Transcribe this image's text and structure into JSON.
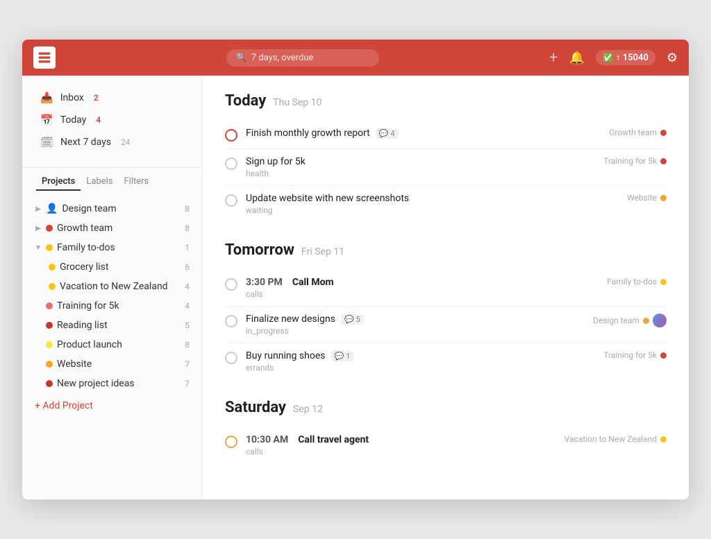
{
  "header": {
    "search_placeholder": "7 days, overdue",
    "karma_label": "↑ 15040",
    "plus_icon": "+",
    "bell_icon": "🔔",
    "settings_icon": "⚙"
  },
  "sidebar": {
    "nav_items": [
      {
        "id": "inbox",
        "label": "Inbox",
        "count": "2",
        "count_type": "red",
        "icon": "inbox"
      },
      {
        "id": "today",
        "label": "Today",
        "count": "4",
        "count_type": "red",
        "icon": "today"
      },
      {
        "id": "next7",
        "label": "Next 7 days",
        "count": "24",
        "count_type": "gray",
        "icon": "calendar"
      }
    ],
    "tabs": [
      "Projects",
      "Labels",
      "Filters"
    ],
    "active_tab": "Projects",
    "projects": [
      {
        "id": "design-team",
        "name": "Design team",
        "count": 8,
        "color": "#e8a84a",
        "arrow": "▶",
        "expanded": false,
        "level": 0
      },
      {
        "id": "growth-team",
        "name": "Growth team",
        "count": 8,
        "color": "#d0453a",
        "arrow": "▶",
        "expanded": false,
        "level": 0
      },
      {
        "id": "family-todos",
        "name": "Family to-dos",
        "count": 1,
        "color": "#f5c518",
        "arrow": "▼",
        "expanded": true,
        "level": 0
      },
      {
        "id": "grocery-list",
        "name": "Grocery list",
        "count": 6,
        "color": "#f5c518",
        "arrow": "",
        "expanded": false,
        "level": 1
      },
      {
        "id": "vacation",
        "name": "Vacation to New Zealand",
        "count": 4,
        "color": "#f5c518",
        "arrow": "",
        "expanded": false,
        "level": 1
      },
      {
        "id": "training",
        "name": "Training for 5k",
        "count": 4,
        "color": "#e87070",
        "arrow": "",
        "expanded": false,
        "level": 0
      },
      {
        "id": "reading",
        "name": "Reading list",
        "count": 5,
        "color": "#c0392b",
        "arrow": "",
        "expanded": false,
        "level": 0
      },
      {
        "id": "product-launch",
        "name": "Product launch",
        "count": 8,
        "color": "#f5e642",
        "arrow": "",
        "expanded": false,
        "level": 0
      },
      {
        "id": "website",
        "name": "Website",
        "count": 7,
        "color": "#f5a623",
        "arrow": "",
        "expanded": false,
        "level": 0
      },
      {
        "id": "new-project-ideas",
        "name": "New project ideas",
        "count": 7,
        "color": "#c0392b",
        "arrow": "",
        "expanded": false,
        "level": 0
      }
    ],
    "add_project_label": "+ Add Project"
  },
  "sections": [
    {
      "id": "today",
      "title": "Today",
      "date": "Thu Sep 10",
      "tasks": [
        {
          "id": "t1",
          "name": "Finish monthly growth report",
          "sub": "",
          "priority": 1,
          "time": "",
          "bold": false,
          "comments": 4,
          "project": "Growth team",
          "project_color": "#d0453a",
          "has_avatar": false
        },
        {
          "id": "t2",
          "name": "Sign up for 5k",
          "sub": "health",
          "priority": 0,
          "time": "",
          "bold": false,
          "comments": 0,
          "project": "Training for 5k",
          "project_color": "#d0453a",
          "has_avatar": false
        },
        {
          "id": "t3",
          "name": "Update website with new screenshots",
          "sub": "waiting",
          "priority": 0,
          "time": "",
          "bold": false,
          "comments": 0,
          "project": "Website",
          "project_color": "#f5a623",
          "has_avatar": false
        }
      ]
    },
    {
      "id": "tomorrow",
      "title": "Tomorrow",
      "date": "Fri Sep 11",
      "tasks": [
        {
          "id": "t4",
          "name": "Call Mom",
          "sub": "calls",
          "priority": 0,
          "time": "3:30 PM",
          "bold": true,
          "comments": 0,
          "project": "Family to-dos",
          "project_color": "#f5c518",
          "has_avatar": false
        },
        {
          "id": "t5",
          "name": "Finalize new designs",
          "sub": "in_progress",
          "priority": 0,
          "time": "",
          "bold": false,
          "comments": 5,
          "project": "Design team",
          "project_color": "#e8a84a",
          "has_avatar": true
        },
        {
          "id": "t6",
          "name": "Buy running shoes",
          "sub": "errands",
          "priority": 0,
          "time": "",
          "bold": false,
          "comments": 1,
          "project": "Training for 5k",
          "project_color": "#d0453a",
          "has_avatar": false
        }
      ]
    },
    {
      "id": "saturday",
      "title": "Saturday",
      "date": "Sep 12",
      "tasks": [
        {
          "id": "t7",
          "name": "Call travel agent",
          "sub": "calls",
          "priority": 2,
          "time": "10:30 AM",
          "bold": true,
          "comments": 0,
          "project": "Vacation to New Zealand",
          "project_color": "#f5c518",
          "has_avatar": false
        }
      ]
    }
  ]
}
